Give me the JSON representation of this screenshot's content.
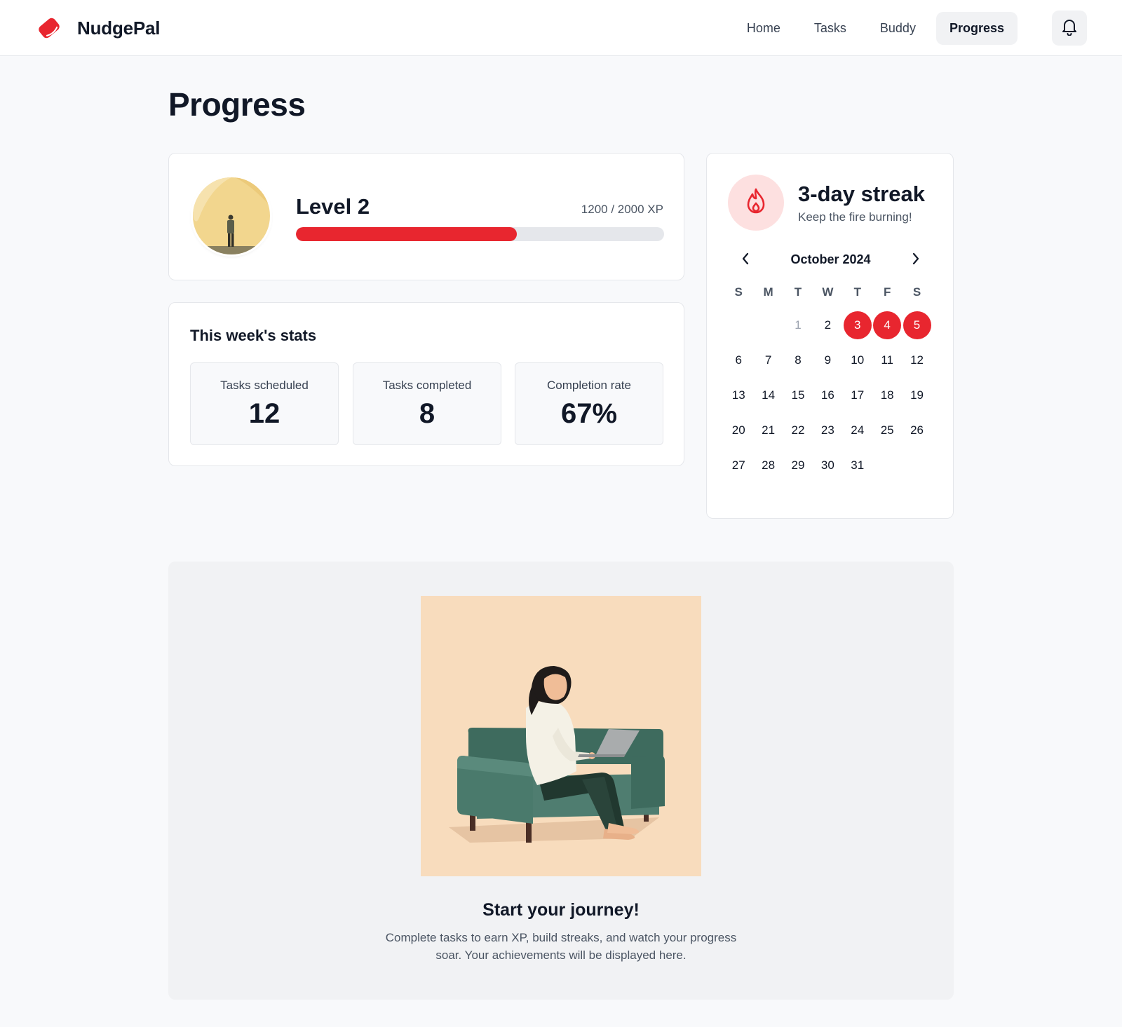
{
  "app": {
    "name": "NudgePal",
    "logo_icon": "tag-logo-icon",
    "accent": "#e8262f"
  },
  "nav": {
    "items": [
      {
        "label": "Home"
      },
      {
        "label": "Tasks"
      },
      {
        "label": "Buddy"
      },
      {
        "label": "Progress",
        "active": true
      }
    ],
    "notifications_icon": "bell-icon"
  },
  "page": {
    "title": "Progress"
  },
  "level": {
    "title": "Level 2",
    "xp_text": "1200 / 2000 XP",
    "xp_current": 1200,
    "xp_total": 2000,
    "progress_fraction": 0.6
  },
  "stats": {
    "title": "This week's stats",
    "items": [
      {
        "label": "Tasks scheduled",
        "value": "12"
      },
      {
        "label": "Tasks completed",
        "value": "8"
      },
      {
        "label": "Completion rate",
        "value": "67%"
      }
    ]
  },
  "streak": {
    "icon": "flame-icon",
    "title": "3-day streak",
    "subtitle": "Keep the fire burning!",
    "calendar": {
      "month_label": "October 2024",
      "weekdays": [
        "S",
        "M",
        "T",
        "W",
        "T",
        "F",
        "S"
      ],
      "first_weekday_index": 2,
      "days_in_month": 31,
      "muted_days": [
        1
      ],
      "streak_days": [
        3,
        4,
        5
      ]
    }
  },
  "empty_state": {
    "title": "Start your journey!",
    "text": "Complete tasks to earn XP, build streaks, and watch your progress soar. Your achievements will be displayed here."
  }
}
